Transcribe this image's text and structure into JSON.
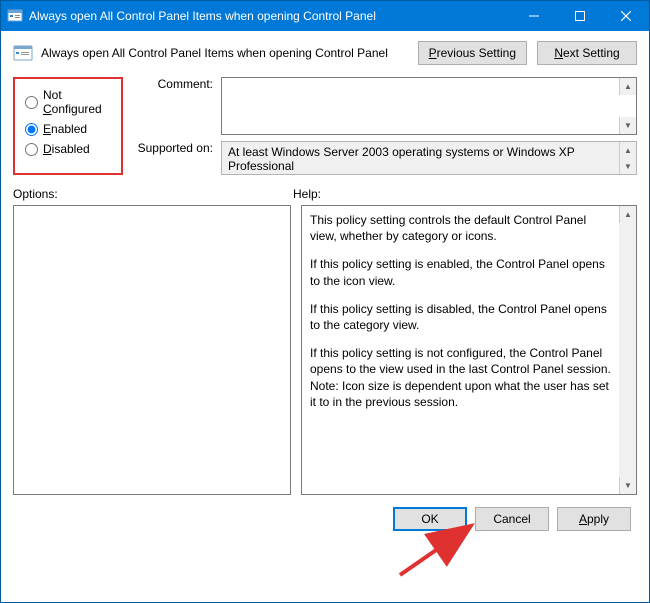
{
  "titlebar": {
    "title": "Always open All Control Panel Items when opening Control Panel"
  },
  "header": {
    "title": "Always open All Control Panel Items when opening Control Panel",
    "prev_btn_pre": "",
    "prev_btn_accel": "P",
    "prev_btn_post": "revious Setting",
    "next_btn_pre": "",
    "next_btn_accel": "N",
    "next_btn_post": "ext Setting"
  },
  "radio": {
    "not_configured_pre": "Not ",
    "not_configured_accel": "C",
    "not_configured_post": "onfigured",
    "enabled_accel": "E",
    "enabled_post": "nabled",
    "disabled_accel": "D",
    "disabled_post": "isabled",
    "selected": "enabled"
  },
  "labels": {
    "comment": "Comment:",
    "supported_on": "Supported on:",
    "options": "Options:",
    "help": "Help:"
  },
  "supported": {
    "text": "At least Windows Server 2003 operating systems or Windows XP Professional"
  },
  "help": {
    "p1": "This policy setting controls the default Control Panel view, whether by category or icons.",
    "p2": "If this policy setting is enabled, the Control Panel opens to the icon view.",
    "p3": "If this policy setting is disabled, the Control Panel opens to the category view.",
    "p4": "If this policy setting is not configured, the Control Panel opens to the view used in the last Control Panel session.",
    "p5": "Note: Icon size is dependent upon what the user has set it to in the previous session."
  },
  "footer": {
    "ok": "OK",
    "cancel": "Cancel",
    "apply_accel": "A",
    "apply_post": "pply"
  }
}
